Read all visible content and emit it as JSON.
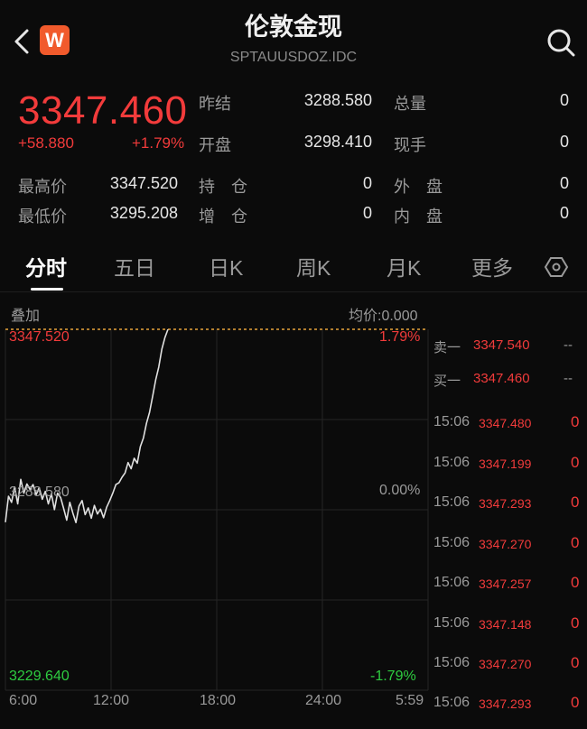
{
  "header": {
    "title": "伦敦金现",
    "subtitle": "SPTAUUSDOZ.IDC",
    "logo_letter": "W"
  },
  "quote": {
    "price": "3347.460",
    "change": "+58.880",
    "change_pct": "+1.79%",
    "stats": [
      {
        "label": "昨结",
        "value": "3288.580"
      },
      {
        "label": "总量",
        "value": "0"
      },
      {
        "label": "开盘",
        "value": "3298.410"
      },
      {
        "label": "现手",
        "value": "0"
      },
      {
        "label": "最高价",
        "value": "3347.520"
      },
      {
        "label": "持　仓",
        "value": "0"
      },
      {
        "label": "外　盘",
        "value": "0"
      },
      {
        "label": "最低价",
        "value": "3295.208"
      },
      {
        "label": "增　仓",
        "value": "0"
      },
      {
        "label": "内　盘",
        "value": "0"
      }
    ]
  },
  "tabs": [
    "分时",
    "五日",
    "日K",
    "周K",
    "月K",
    "更多"
  ],
  "active_tab": "分时",
  "chart": {
    "overlay_label": "叠加",
    "avg_price_label": "均价:0.000",
    "high_price": "3347.520",
    "high_pct": "1.79%",
    "mid_price": "3288.580",
    "mid_pct": "0.00%",
    "low_price": "3229.640",
    "low_pct": "-1.79%",
    "time_labels": [
      "6:00",
      "12:00",
      "18:00",
      "24:00",
      "5:59"
    ]
  },
  "order_book": [
    {
      "label": "卖一",
      "price": "3347.540",
      "volume": "--"
    },
    {
      "label": "买一",
      "price": "3347.460",
      "volume": "--"
    }
  ],
  "ticks": [
    {
      "time": "15:06",
      "price": "3347.480",
      "volume": "0"
    },
    {
      "time": "15:06",
      "price": "3347.199",
      "volume": "0"
    },
    {
      "time": "15:06",
      "price": "3347.293",
      "volume": "0"
    },
    {
      "time": "15:06",
      "price": "3347.270",
      "volume": "0"
    },
    {
      "time": "15:06",
      "price": "3347.257",
      "volume": "0"
    },
    {
      "time": "15:06",
      "price": "3347.148",
      "volume": "0"
    },
    {
      "time": "15:06",
      "price": "3347.270",
      "volume": "0"
    },
    {
      "time": "15:06",
      "price": "3347.293",
      "volume": "0"
    }
  ],
  "colors": {
    "up": "#f23b3b",
    "down": "#2ecc40",
    "line": "#e0e0e0",
    "ref_dash": "#e8a33a",
    "brand": "#f15a2c"
  },
  "chart_data": {
    "type": "line",
    "title": "",
    "xlabel": "",
    "ylabel": "",
    "x_ticks": [
      "6:00",
      "12:00",
      "18:00",
      "24:00",
      "5:59"
    ],
    "ylim": [
      3229.64,
      3347.52
    ],
    "reference": 3288.58,
    "series": [
      {
        "values": [
          3284.5,
          3293.0,
          3291.0,
          3296.0,
          3290.5,
          3298.5,
          3294.0,
          3297.0,
          3295.2,
          3296.8,
          3293.5,
          3295.8,
          3292.0,
          3294.6,
          3290.5,
          3293.8,
          3288.6,
          3294.0,
          3292.6,
          3289.0,
          3285.2,
          3291.0,
          3287.5,
          3284.4,
          3289.8,
          3291.6,
          3287.0,
          3289.2,
          3285.8,
          3290.0,
          3287.2,
          3288.8,
          3286.0,
          3289.4,
          3291.6,
          3294.0,
          3296.8,
          3297.4,
          3299.2,
          3300.6,
          3304.0,
          3302.0,
          3305.4,
          3303.8,
          3309.2,
          3312.0,
          3316.8,
          3320.4,
          3325.6,
          3331.0,
          3335.2,
          3341.0,
          3344.8,
          3347.52
        ]
      }
    ]
  }
}
